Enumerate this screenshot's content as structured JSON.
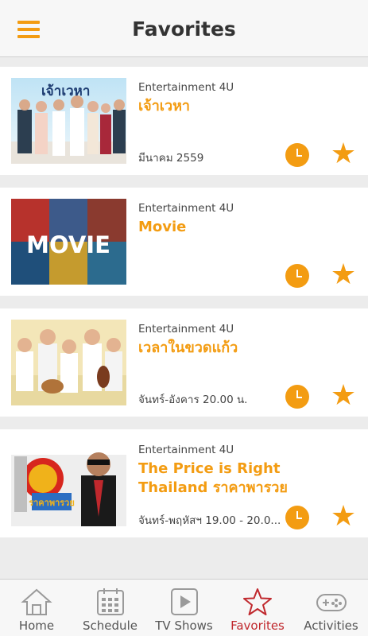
{
  "header": {
    "title": "Favorites"
  },
  "favorites": [
    {
      "channel": "Entertainment 4U",
      "title": "เจ้าเวหา",
      "airtime": "มีนาคม 2559",
      "thumb_text": "เจ้าเวหา"
    },
    {
      "channel": "Entertainment 4U",
      "title": "Movie",
      "airtime": "",
      "thumb_text": "MOVIE"
    },
    {
      "channel": "Entertainment 4U",
      "title": "เวลาในขวดแก้ว",
      "airtime": "จันทร์-อังคาร 20.00 น.",
      "thumb_text": ""
    },
    {
      "channel": "Entertainment 4U",
      "title": "The Price is Right Thailand ราคาพารวย",
      "airtime": "จันทร์-พฤหัสฯ 19.00 - 20.0...",
      "thumb_text": "ราคาพารวย"
    }
  ],
  "tabs": [
    {
      "label": "Home",
      "icon": "home-icon"
    },
    {
      "label": "Schedule",
      "icon": "calendar-icon"
    },
    {
      "label": "TV Shows",
      "icon": "play-icon"
    },
    {
      "label": "Favorites",
      "icon": "star-icon"
    },
    {
      "label": "Activities",
      "icon": "gamepad-icon"
    }
  ],
  "colors": {
    "accent": "#f39c12",
    "active_tab": "#c0282d"
  }
}
